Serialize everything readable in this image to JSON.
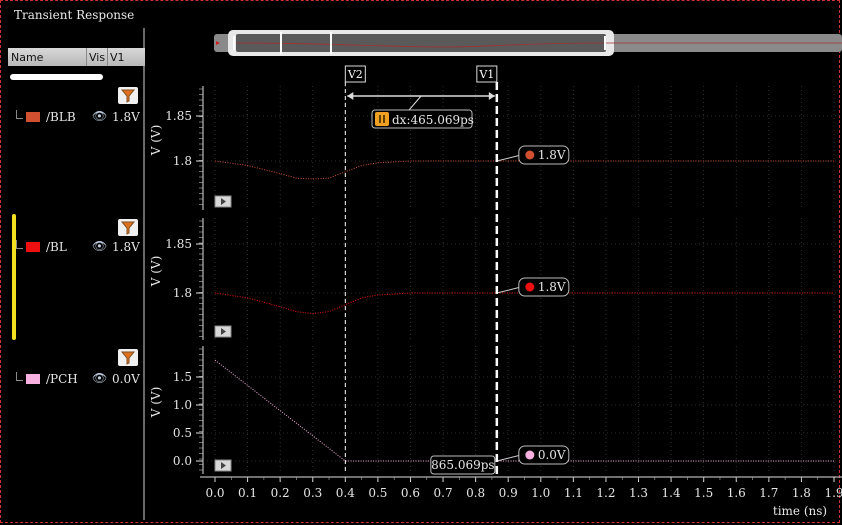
{
  "window": {
    "title": "Transient Response"
  },
  "columns": {
    "name": "Name",
    "vis": "Vis",
    "v1": "V1"
  },
  "signals": [
    {
      "name": "/BLB",
      "value": "1.8V",
      "color": "#d05030"
    },
    {
      "name": "/BL",
      "value": "1.8V",
      "color": "#ee1010"
    },
    {
      "name": "/PCH",
      "value": "0.0V",
      "color": "#f8b0e0"
    }
  ],
  "cursors": {
    "v2_label": "V2",
    "v1_label": "V1",
    "dx_label": "dx:465.069ps",
    "v1_time_label": "865.069ps",
    "v1_time": 0.865069,
    "v2_time": 0.4
  },
  "chart_data": [
    {
      "type": "line",
      "signal": "/BLB",
      "ylabel": "V (V)",
      "ylim": [
        1.76,
        1.88
      ],
      "yticks": [
        1.8,
        1.85
      ],
      "ytick_labels": [
        "1.8",
        "1.85"
      ],
      "marker_label": "1.8V",
      "x": [
        0.0,
        0.1,
        0.2,
        0.25,
        0.3,
        0.35,
        0.4,
        0.45,
        0.5,
        0.6,
        0.7,
        0.8,
        0.9,
        1.9
      ],
      "y": [
        1.8,
        1.795,
        1.786,
        1.781,
        1.78,
        1.781,
        1.788,
        1.795,
        1.798,
        1.8,
        1.8,
        1.8,
        1.8,
        1.8
      ]
    },
    {
      "type": "line",
      "signal": "/BL",
      "ylabel": "V (V)",
      "ylim": [
        1.76,
        1.88
      ],
      "yticks": [
        1.8,
        1.85
      ],
      "ytick_labels": [
        "1.8",
        "1.85"
      ],
      "marker_label": "1.8V",
      "x": [
        0.0,
        0.1,
        0.2,
        0.25,
        0.3,
        0.35,
        0.4,
        0.45,
        0.5,
        0.6,
        0.7,
        0.8,
        0.9,
        1.9
      ],
      "y": [
        1.8,
        1.795,
        1.786,
        1.781,
        1.779,
        1.781,
        1.788,
        1.795,
        1.798,
        1.8,
        1.8,
        1.8,
        1.8,
        1.8
      ]
    },
    {
      "type": "line",
      "signal": "/PCH",
      "ylabel": "V (V)",
      "ylim": [
        -0.1,
        1.9
      ],
      "yticks": [
        0.0,
        0.5,
        1.0,
        1.5
      ],
      "ytick_labels": [
        "0.0",
        "0.5",
        "1.0",
        "1.5"
      ],
      "marker_label": "0.0V",
      "x": [
        0.0,
        0.4,
        0.41,
        1.9
      ],
      "y": [
        1.8,
        0.0,
        0.0,
        0.0
      ]
    }
  ],
  "x_axis": {
    "label": "time (ns)",
    "range": [
      0.0,
      1.9
    ],
    "ticks": [
      "0.0",
      "0.1",
      "0.2",
      "0.3",
      "0.4",
      "0.5",
      "0.6",
      "0.7",
      "0.8",
      "0.9",
      "1.0",
      "1.1",
      "1.2",
      "1.3",
      "1.4",
      "1.5",
      "1.6",
      "1.7",
      "1.8",
      "1.9"
    ]
  }
}
